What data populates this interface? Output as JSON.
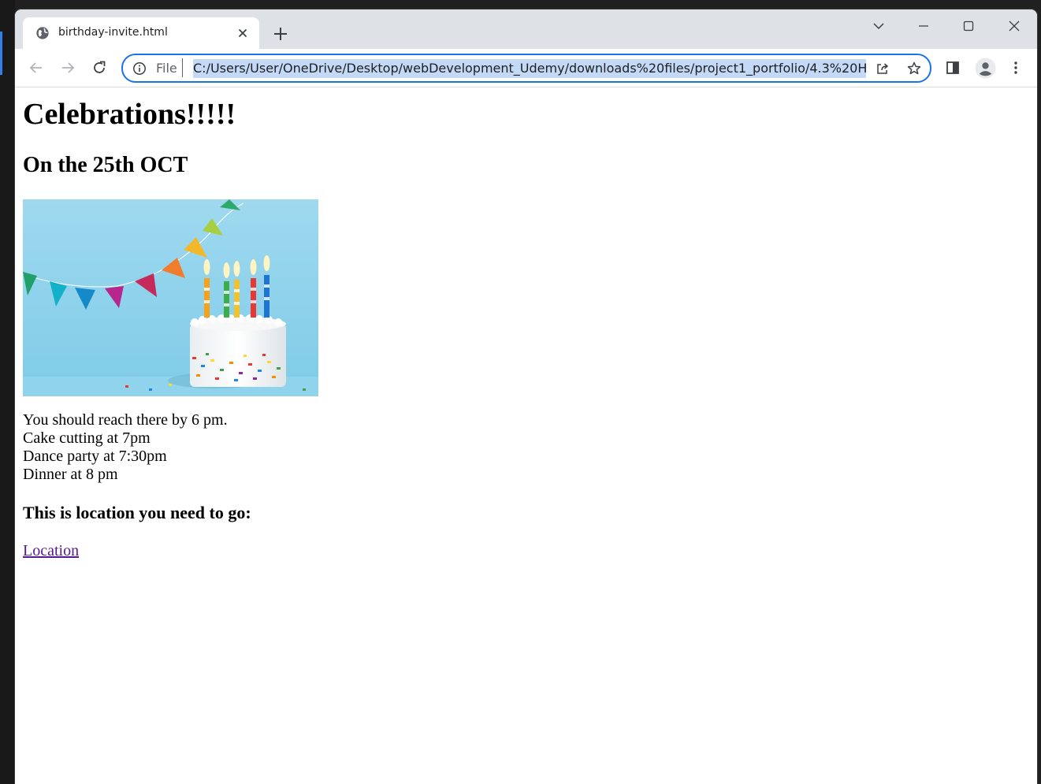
{
  "browser": {
    "tab_title": "birthday-invite.html",
    "url_scheme": "File",
    "url": "C:/Users/User/OneDrive/Desktop/webDevelopment_Udemy/downloads%20files/project1_portfolio/4.3%20HTM",
    "accent_color": "#1a73e8",
    "selection_color": "#c3d9f6",
    "icons": [
      "globe-icon",
      "close-icon",
      "new-tab-icon",
      "tab-search-icon",
      "minimize-icon",
      "maximize-icon",
      "window-close-icon",
      "back-icon",
      "forward-icon",
      "reload-icon",
      "info-icon",
      "share-icon",
      "bookmark-star-icon",
      "side-panel-icon",
      "profile-icon",
      "menu-icon"
    ]
  },
  "page": {
    "heading": "Celebrations!!!!!",
    "subheading": "On the 25th OCT",
    "schedule": [
      "You should reach there by 6 pm.",
      "Cake cutting at 7pm",
      "Dance party at 7:30pm",
      "Dinner at 8 pm"
    ],
    "location_heading": "This is location you need to go:",
    "location_link": "Location",
    "link_color": "#551a8b"
  }
}
